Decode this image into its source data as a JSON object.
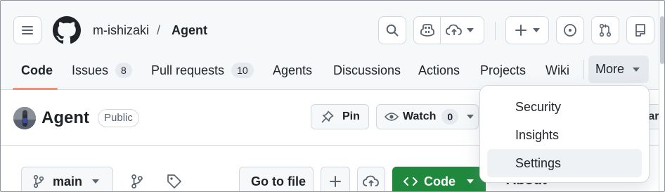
{
  "header": {
    "owner": "m-ishizaki",
    "separator": "/",
    "repo": "Agent"
  },
  "tabs": [
    {
      "label": "Code",
      "selected": true
    },
    {
      "label": "Issues",
      "count": "8"
    },
    {
      "label": "Pull requests",
      "count": "10"
    },
    {
      "label": "Agents"
    },
    {
      "label": "Discussions"
    },
    {
      "label": "Actions"
    },
    {
      "label": "Projects"
    },
    {
      "label": "Wiki"
    }
  ],
  "more": {
    "label": "More"
  },
  "repohead": {
    "title": "Agent",
    "visibility": "Public",
    "pin_label": "Pin",
    "watch_label": "Watch",
    "watch_count": "0",
    "star_partial": "tar"
  },
  "toolbar": {
    "branch": "main",
    "go_to_file": "Go to file",
    "code_label": "Code",
    "about_label": "About"
  },
  "dropdown": {
    "items": [
      {
        "label": "Security"
      },
      {
        "label": "Insights"
      },
      {
        "label": "Settings",
        "highlighted": true
      }
    ]
  },
  "colors": {
    "accent_underline": "#fd8c73",
    "code_button": "#1f883d",
    "header_bg": "#f6f8fa",
    "border": "#d1d9e0"
  },
  "icons": [
    "hamburger-icon",
    "github-logo-icon",
    "search-icon",
    "copilot-icon",
    "cloud-upload-icon",
    "plus-icon",
    "issue-icon",
    "pull-request-icon",
    "inbox-icon",
    "pin-icon",
    "eye-icon",
    "branch-icon",
    "tag-icon",
    "code-icon",
    "chevron-down-icon"
  ]
}
